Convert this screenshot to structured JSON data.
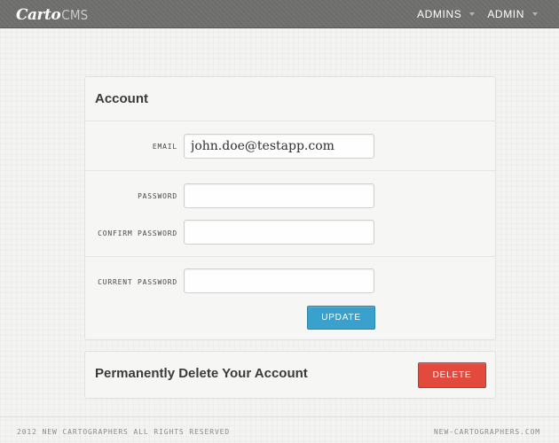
{
  "header": {
    "logo_script": "Carto",
    "logo_suffix": "CMS",
    "nav": [
      "ADMINS",
      "ADMIN"
    ]
  },
  "account": {
    "title": "Account",
    "email_label": "EMAIL",
    "email_value": "john.doe@testapp.com",
    "password_label": "PASSWORD",
    "confirm_label": "CONFIRM PASSWORD",
    "current_label": "CURRENT PASSWORD",
    "update_label": "UPDATE"
  },
  "delete": {
    "title": "Permanently Delete Your Account",
    "button_label": "DELETE"
  },
  "footer": {
    "left": "2012 NEW CARTOGRAPHERS ALL RIGHTS RESERVED",
    "right": "NEW-CARTOGRAPHERS.COM"
  },
  "colors": {
    "update_button": "#3aa0cc",
    "delete_button": "#e4493e",
    "topbar": "#6d6d6b"
  }
}
